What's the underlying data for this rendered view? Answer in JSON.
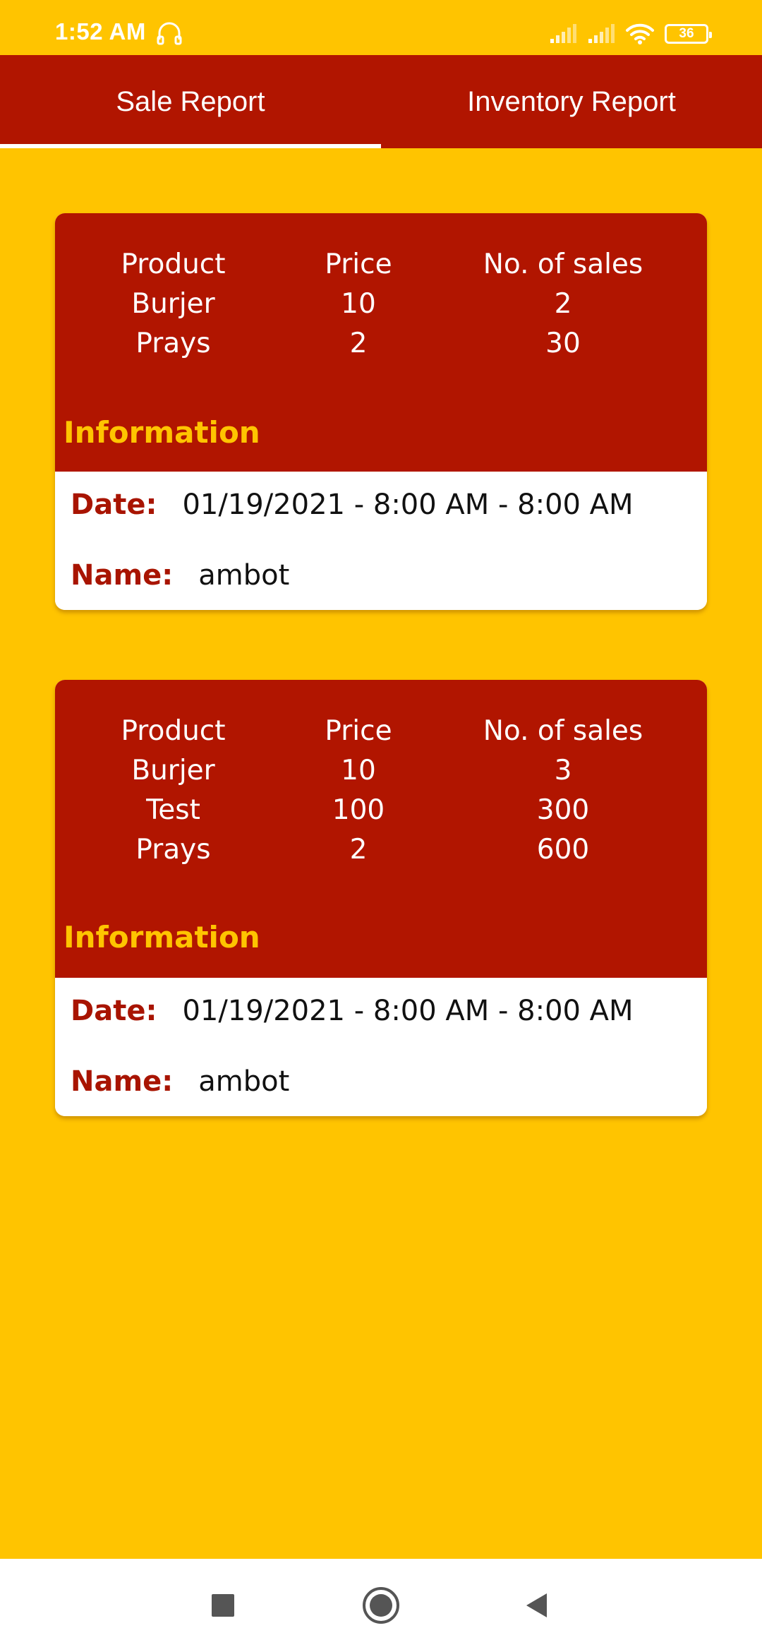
{
  "status_bar": {
    "time": "1:52 AM",
    "battery": "36",
    "icons": [
      "headset-icon",
      "signal-icon",
      "signal-icon",
      "wifi-icon",
      "battery-icon"
    ]
  },
  "tabs": [
    {
      "label": "Sale Report",
      "active": true
    },
    {
      "label": "Inventory Report",
      "active": false
    }
  ],
  "table_headers": {
    "product": "Product",
    "price": "Price",
    "sales": "No. of sales"
  },
  "info_heading": "Information",
  "labels": {
    "date": "Date:",
    "name": "Name:"
  },
  "reports": [
    {
      "rows": [
        {
          "product": "Burjer",
          "price": "10",
          "sales": "2"
        },
        {
          "product": "Prays",
          "price": "2",
          "sales": "30"
        }
      ],
      "date": "01/19/2021 - 8:00 AM - 8:00 AM",
      "name": "ambot"
    },
    {
      "rows": [
        {
          "product": "Burjer",
          "price": "10",
          "sales": "3"
        },
        {
          "product": "Test",
          "price": "100",
          "sales": "300"
        },
        {
          "product": "Prays",
          "price": "2",
          "sales": "600"
        }
      ],
      "date": "01/19/2021 - 8:00 AM - 8:00 AM",
      "name": "ambot"
    }
  ],
  "nav_bar": {
    "icons": [
      "recents-square-icon",
      "home-circle-icon",
      "back-triangle-icon"
    ]
  },
  "colors": {
    "background": "#FFC400",
    "primary": "#B11500",
    "heading": "#FFC400",
    "label": "#A81400",
    "card_bottom": "#FFFFFF"
  }
}
